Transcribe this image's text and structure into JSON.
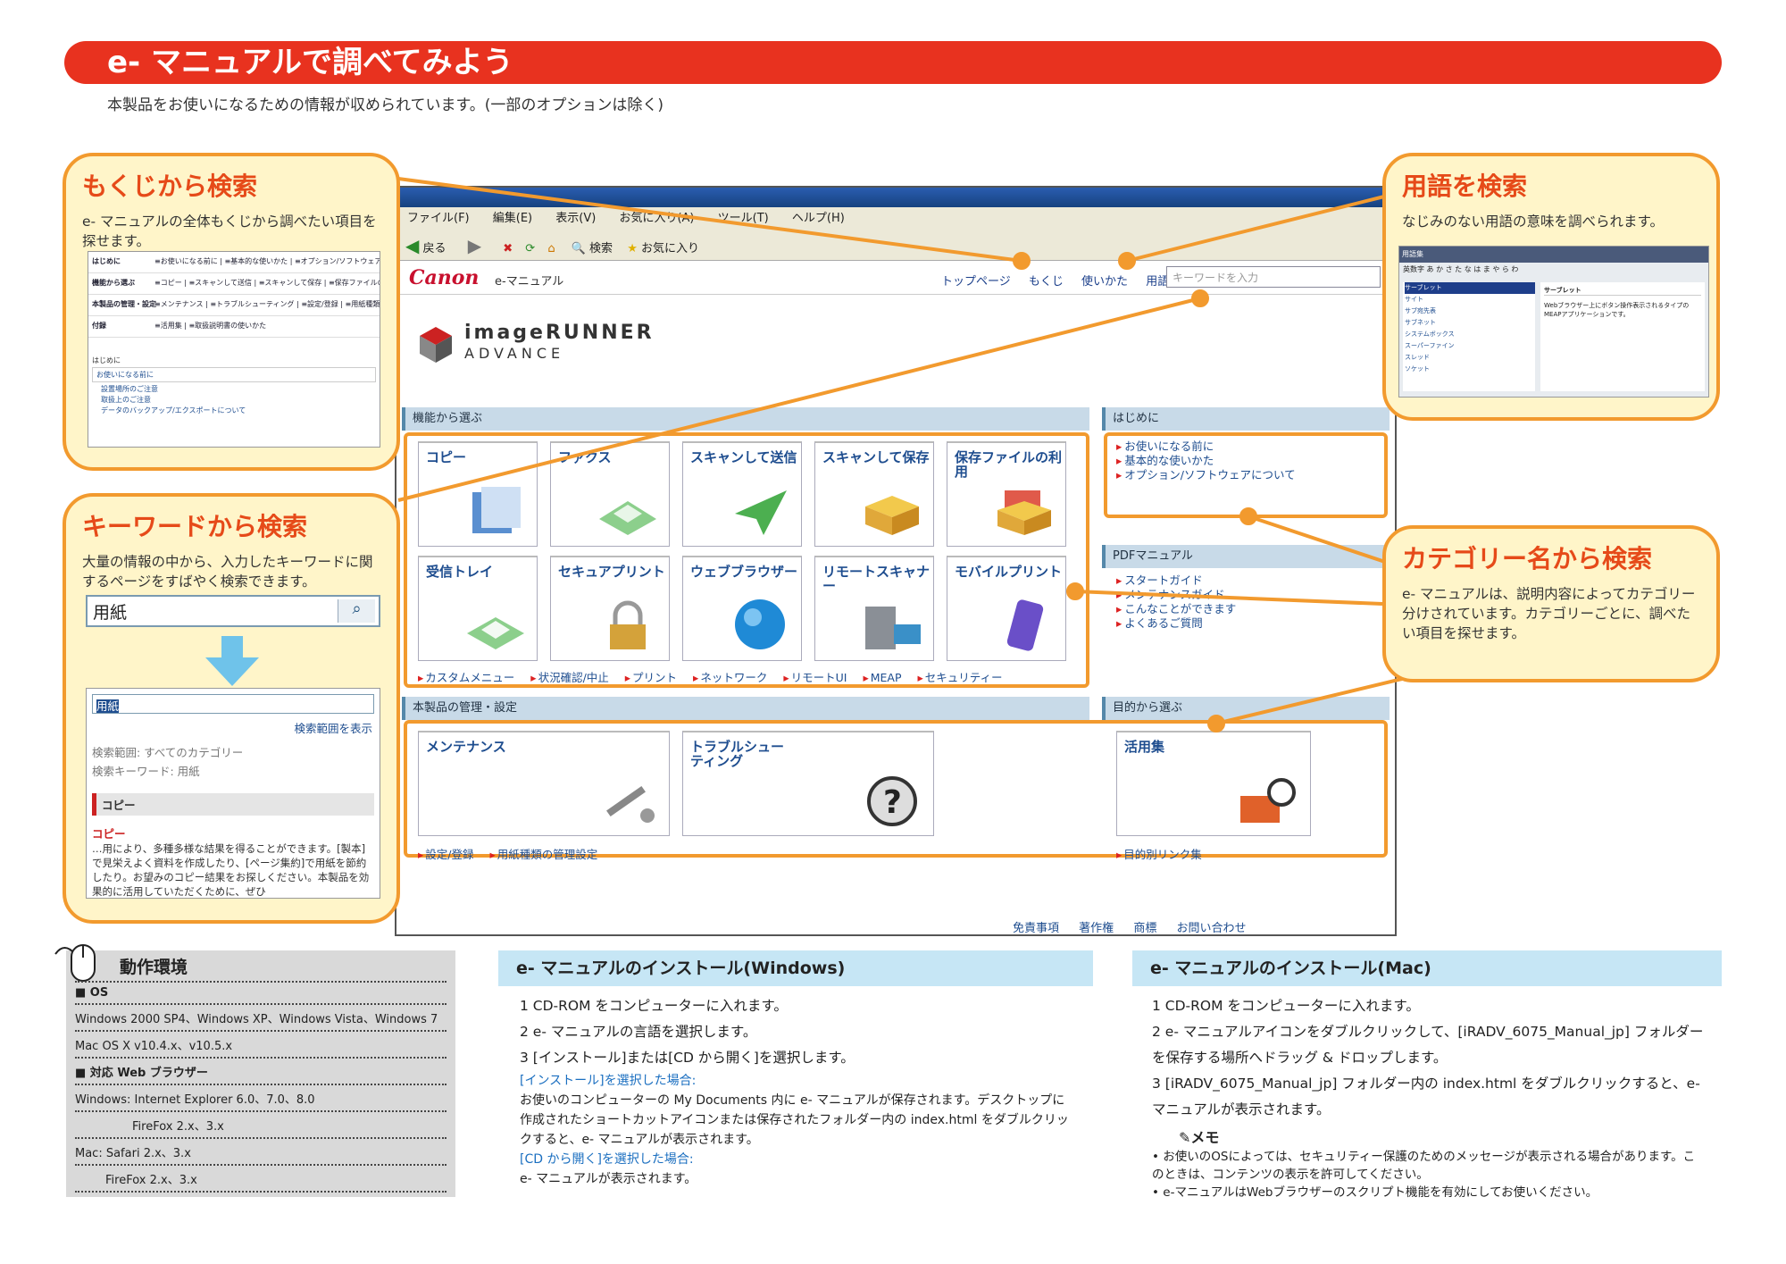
{
  "header": {
    "title": "e- マニュアルで調べてみよう",
    "intro": "本製品をお使いになるための情報が収められています。(一部のオプションは除く)"
  },
  "callouts": {
    "toc": {
      "title": "もくじから検索",
      "desc": "e- マニュアルの全体もくじから調べたい項目を探せます。",
      "mini_rows": [
        {
          "head": "はじめに",
          "links": "≡お使いになる前に | ≡基本的な使いかた | ≡オプション/ソフトウェアに"
        },
        {
          "head": "機能から選ぶ",
          "links": "≡コピー | ≡スキャンして送信 | ≡スキャンして保存 | ≡保存ファイルの"
        },
        {
          "head": "本製品の管理・設定",
          "links": "≡メンテナンス | ≡トラブルシューティング | ≡設定/登録 | ≡用紙種類"
        },
        {
          "head": "付録",
          "links": "≡活用集 | ≡取扱説明書の使いかた"
        }
      ],
      "mini_section": "はじめに",
      "mini_sub": "お使いになる前に",
      "mini_items": [
        "設置場所のご注意",
        "取扱上のご注意",
        "データのバックアップ/エクスポートについて"
      ]
    },
    "keyword": {
      "title": "キーワードから検索",
      "desc": "大量の情報の中から、入力したキーワードに関するページをすばやく検索できます。",
      "input_value": "用紙",
      "result_input": "用紙",
      "scope_link": "検索範囲を表示",
      "scope_label": "検索範囲: すべてのカテゴリー",
      "keyword_label": "検索キーワード: 用紙",
      "category": "コピー",
      "result_title": "コピー",
      "result_text": "…用により、多種多様な結果を得ることができます。[製本]で見栄えよく資料を作成したり、[ページ集約]で用紙を節約したり。お望みのコピー結果をお探しください。本製品を効果的に活用していただくために、ぜひ"
    },
    "glossary": {
      "title": "用語を検索",
      "desc": "なじみのない用語の意味を調べられます。",
      "mini_title": "用語集",
      "mini_tabs": "英数字 あ か さ た な は ま や ら わ",
      "mini_items": [
        "サーブレット",
        "サイト",
        "サブ宛先表",
        "サブネット",
        "システムボックス",
        "スーパーファイン",
        "スレッド",
        "ソケット"
      ],
      "mini_detail_title": "サーブレット",
      "mini_detail_text": "Webブラウザー上にボタン操作表示されるタイプのMEAPアプリケーションです。"
    },
    "category": {
      "title": "カテゴリー名から検索",
      "desc": "e- マニュアルは、説明内容によってカテゴリー分けされています。カテゴリーごとに、調べたい項目を探せます。"
    }
  },
  "browser": {
    "menu": [
      "ファイル(F)",
      "編集(E)",
      "表示(V)",
      "お気に入り(A)",
      "ツール(T)",
      "ヘルプ(H)"
    ],
    "toolbar": {
      "back": "戻る",
      "search": "検索",
      "favorites": "お気に入り"
    },
    "logo": "Canon",
    "logo_sub": "e-マニュアル",
    "header_links": [
      "トップページ",
      "もくじ",
      "使いかた",
      "用語集"
    ],
    "search_placeholder": "キーワードを入力",
    "product_line1": "imageRUNNER",
    "product_line2": "ADVANCE",
    "sec_function": "機能から選ぶ",
    "sec_intro": "はじめに",
    "sec_pdf": "PDFマニュアル",
    "sec_manage": "本製品の管理・設定",
    "sec_purpose": "目的から選ぶ",
    "function_tiles": [
      "コピー",
      "ファクス",
      "スキャンして送信",
      "スキャンして保存",
      "保存ファイルの利用",
      "受信トレイ",
      "セキュアプリント",
      "ウェブブラウザー",
      "リモートスキャナー",
      "モバイルプリント"
    ],
    "function_links": [
      "カスタムメニュー",
      "状況確認/中止",
      "プリント",
      "ネットワーク",
      "リモートUI",
      "MEAP",
      "セキュリティー"
    ],
    "intro_links": [
      "お使いになる前に",
      "基本的な使いかた",
      "オプション/ソフトウェアについて"
    ],
    "pdf_links": [
      "スタートガイド",
      "メンテナンスガイド",
      "こんなことができます",
      "よくあるご質問"
    ],
    "manage_tiles": [
      "メンテナンス",
      "トラブルシューティング"
    ],
    "manage_links": [
      "設定/登録",
      "用紙種類の管理設定"
    ],
    "purpose_tile": "活用集",
    "purpose_links": [
      "目的別リンク集"
    ],
    "footer_links": [
      "免責事項",
      "著作権",
      "商標",
      "お問い合わせ"
    ]
  },
  "environment": {
    "title": "動作環境",
    "os_head": "■ OS",
    "os_win": "Windows 2000 SP4、Windows XP、Windows Vista、Windows 7",
    "os_mac": "Mac OS X v10.4.x、v10.5.x",
    "browser_head": "■ 対応 Web ブラウザー",
    "win_ie": "Windows: Internet Explorer 6.0、7.0、8.0",
    "win_ff": "FireFox 2.x、3.x",
    "mac_safari": "Mac: Safari 2.x、3.x",
    "mac_ff": "FireFox 2.x、3.x"
  },
  "install_windows": {
    "title": "e- マニュアルのインストール(Windows)",
    "steps": [
      "1 CD-ROM をコンピューターに入れます。",
      "2 e- マニュアルの言語を選択します。",
      "3 [インストール]または[CD から開く]を選択します。"
    ],
    "case1_head": "[インストール]を選択した場合:",
    "case1_text": "お使いのコンピューターの My Documents 内に e- マニュアルが保存されます。デスクトップに作成されたショートカットアイコンまたは保存されたフォルダー内の index.html をダブルクリックすると、e- マニュアルが表示されます。",
    "case2_head": "[CD から開く]を選択した場合:",
    "case2_text": "e- マニュアルが表示されます。"
  },
  "install_mac": {
    "title": "e- マニュアルのインストール(Mac)",
    "steps": [
      "1 CD-ROM をコンピューターに入れます。",
      "2 e- マニュアルアイコンをダブルクリックして、[iRADV_6075_Manual_jp] フォルダーを保存する場所へドラッグ & ドロップします。",
      "3 [iRADV_6075_Manual_jp] フォルダー内の index.html をダブルクリックすると、e- マニュアルが表示されます。"
    ],
    "memo_head": "メモ",
    "memo_items": [
      "お使いのOSによっては、セキュリティー保護のためのメッセージが表示される場合があります。このときは、コンテンツの表示を許可してください。",
      "e-マニュアルはWebブラウザーのスクリプト機能を有効にしてお使いください。"
    ]
  },
  "colors": {
    "title_red": "#e8321f",
    "callout_orange": "#f29a2e",
    "callout_fill": "#fff5c9",
    "heading_blue": "#c6e6f5"
  }
}
